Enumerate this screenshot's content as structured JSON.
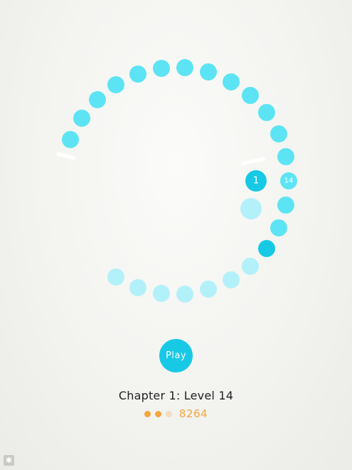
{
  "game": {
    "colors": {
      "dot": "#5de4f4",
      "dot_faded": "#b3f1fa",
      "dot_active": "#17c9e4",
      "bar": "#ffffff",
      "star_on": "#f5a53c",
      "star_off": "#f3dcc0"
    },
    "active_dot_label": "1",
    "level_dot_label": "14"
  },
  "menu": {
    "play_label": "Play",
    "level_title": "Chapter 1: Level 14",
    "stars_earned": 2,
    "stars_total": 3,
    "score": "8264",
    "settings_icon": "gear-icon"
  }
}
